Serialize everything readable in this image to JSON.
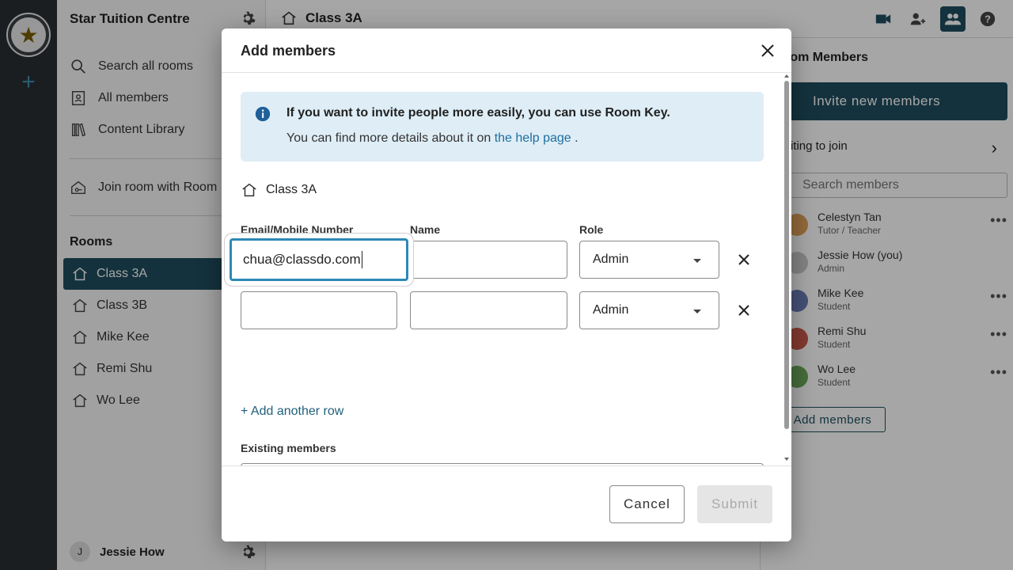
{
  "sidebar": {
    "org_name": "Star Tuition Centre",
    "nav": {
      "search": "Search all rooms",
      "all_members": "All members",
      "content_library": "Content Library",
      "join_room": "Join room with Room Key"
    },
    "rooms_heading": "Rooms",
    "rooms": [
      {
        "label": "Class 3A",
        "active": true
      },
      {
        "label": "Class 3B",
        "active": false
      },
      {
        "label": "Mike Kee",
        "active": false
      },
      {
        "label": "Remi Shu",
        "active": false
      },
      {
        "label": "Wo Lee",
        "active": false
      }
    ],
    "user": {
      "initial": "J",
      "name": "Jessie How"
    }
  },
  "topbar": {
    "room_title": "Class 3A"
  },
  "members_panel": {
    "title": "Room Members",
    "invite_button": "Invite new members",
    "waiting": "Waiting to join",
    "search_placeholder": "Search members",
    "members": [
      {
        "name": "Celestyn Tan",
        "role": "Tutor / Teacher",
        "color": "#e0a25a",
        "more": "•••"
      },
      {
        "name": "Jessie How (you)",
        "role": "Admin",
        "color": "#c9c9c9",
        "more": ""
      },
      {
        "name": "Mike Kee",
        "role": "Student",
        "color": "#6b7bb5",
        "more": "•••"
      },
      {
        "name": "Remi Shu",
        "role": "Student",
        "color": "#c85a4a",
        "more": "•••"
      },
      {
        "name": "Wo Lee",
        "role": "Student",
        "color": "#6aa85a",
        "more": "•••"
      }
    ],
    "add_members": "Add members"
  },
  "modal": {
    "title": "Add members",
    "info_line1": "If you want to invite people more easily, you can use Room Key.",
    "info_line2_prefix": "You can find more details about it on ",
    "info_link": "the help page",
    "info_line2_suffix": " .",
    "room": "Class 3A",
    "columns": {
      "email": "Email/Mobile Number",
      "name": "Name",
      "role": "Role"
    },
    "rows": [
      {
        "email": "chua@classdo.com",
        "name": "",
        "role": "Admin"
      },
      {
        "email": "",
        "name": "",
        "role": "Admin"
      }
    ],
    "add_row": "+ Add another row",
    "existing_members_label": "Existing members",
    "existing_members_value": "",
    "cancel": "Cancel",
    "submit": "Submit"
  },
  "colors": {
    "accent": "#1f4e5f",
    "focus": "#2d89b5",
    "info_bg": "#deedf6",
    "link": "#1f6fa0"
  }
}
